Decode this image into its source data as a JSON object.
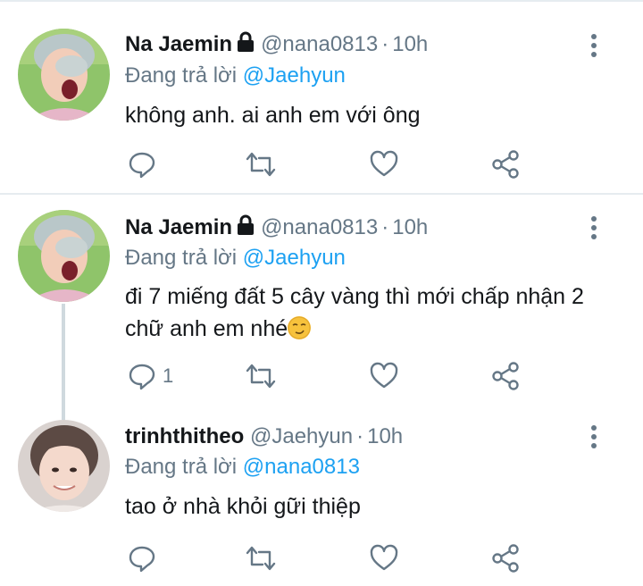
{
  "colors": {
    "accent": "#1da1f2",
    "muted": "#657786",
    "text": "#14171a",
    "divider": "#e6ecf0"
  },
  "tweets": [
    {
      "name": "Na Jaemin",
      "handle": "@nana0813",
      "dot": "·",
      "time": "10h",
      "replying_label": "Đang trả lời",
      "replying_to": "@Jaehyun",
      "text": "không anh. ai anh em với ông",
      "reply_count": "",
      "icons": [
        "lock-icon",
        "more-icon",
        "reply-icon",
        "retweet-icon",
        "like-icon",
        "share-icon"
      ]
    },
    {
      "name": "Na Jaemin",
      "handle": "@nana0813",
      "dot": "·",
      "time": "10h",
      "replying_label": "Đang trả lời",
      "replying_to": "@Jaehyun",
      "text": "đi 7 miếng đất 5 cây vàng thì mới chấp nhận 2 chữ anh em nhé",
      "emoji": "smirking-face-emoji",
      "reply_count": "1",
      "icons": [
        "lock-icon",
        "more-icon",
        "reply-icon",
        "retweet-icon",
        "like-icon",
        "share-icon"
      ]
    },
    {
      "name": "trinhthitheo",
      "handle": "@Jaehyun",
      "dot": "·",
      "time": "10h",
      "replying_label": "Đang trả lời",
      "replying_to": "@nana0813",
      "text": "tao ở nhà khỏi gữi thiệp",
      "reply_count": "",
      "icons": [
        "more-icon",
        "reply-icon",
        "retweet-icon",
        "like-icon",
        "share-icon"
      ]
    }
  ]
}
